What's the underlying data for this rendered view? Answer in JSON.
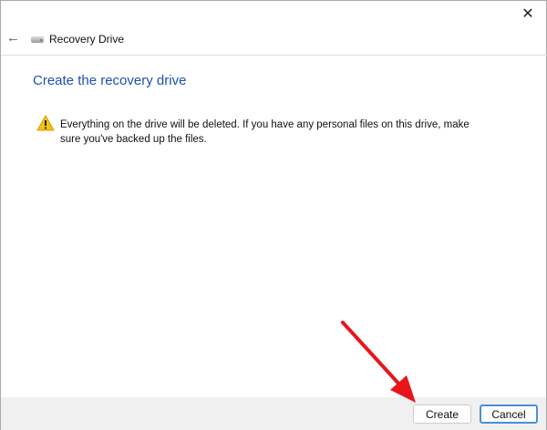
{
  "window": {
    "title": "Recovery Drive",
    "close_icon": "close-icon",
    "back_icon": "back-arrow-icon"
  },
  "main": {
    "heading": "Create the recovery drive",
    "warning": "Everything on the drive will be deleted. If you have any personal files on this drive, make sure you've backed up the files."
  },
  "footer": {
    "create_label": "Create",
    "cancel_label": "Cancel"
  },
  "annotation": {
    "arrow_color": "#e8141c"
  }
}
